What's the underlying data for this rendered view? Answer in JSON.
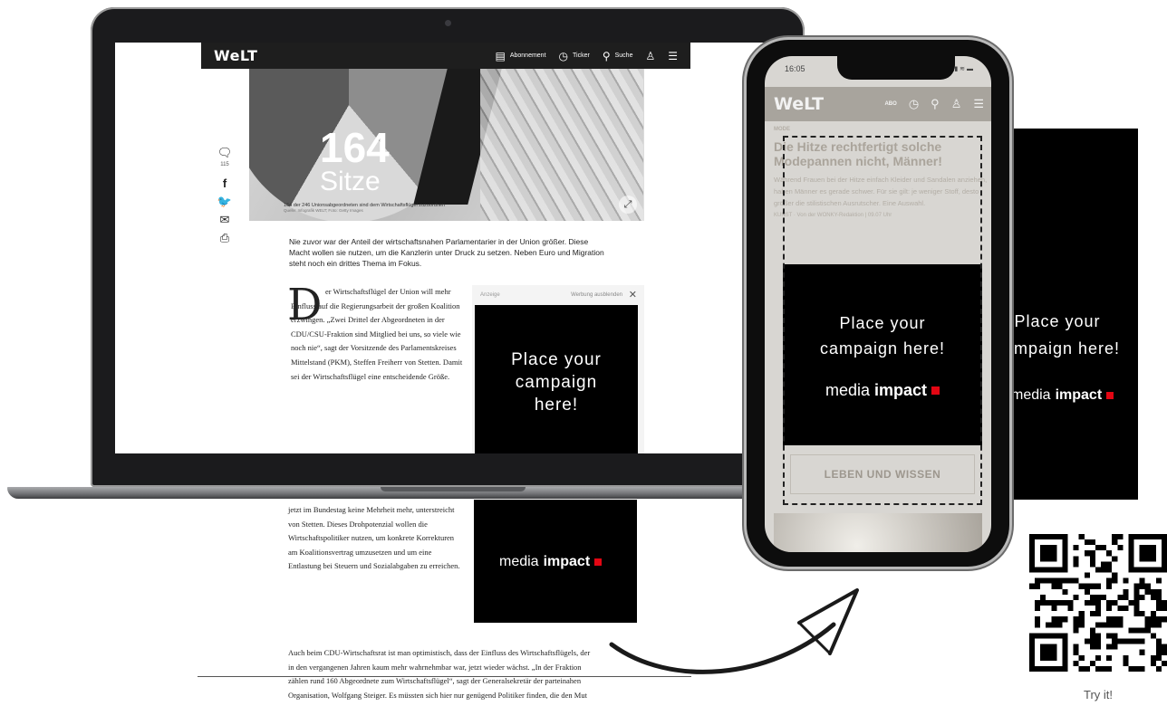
{
  "laptop": {
    "site": {
      "logo": "WeLT",
      "nav": [
        {
          "label": "Abonnement",
          "icon": "newspaper-icon"
        },
        {
          "label": "Ticker",
          "icon": "ticker-icon"
        },
        {
          "label": "Suche",
          "icon": "search-icon"
        }
      ]
    },
    "hero": {
      "number": "164",
      "word": "Sitze",
      "caption": "164 der 246 Unionsabgeordneten sind dem Wirtschaftsflügel zuzuordnen",
      "credit": "Quelle: Infografik WELT; Foto: Getty Images"
    },
    "social": {
      "comment_count": "115"
    },
    "lead": "Nie zuvor war der Anteil der wirtschaftsnahen Parlamentarier in der Union größer. Diese Macht wollen sie nutzen, um die Kanzlerin unter Druck zu setzen. Neben Euro und Migration steht noch ein drittes Thema im Fokus.",
    "dropcap": "D",
    "body": "er Wirtschaftsflügel der Union will mehr Einfluss auf die Regierungsarbeit der großen Koalition erzwingen. „Zwei Drittel der Abgeordneten in der CDU/CSU-Fraktion sind Mitglied bei uns, so viele wie noch nie“, sagt der Vorsitzende des Parlamentskreises Mittelstand (PKM), Steffen Freiherr von Stetten. Damit sei der Wirtschaftsflügel eine entscheidende Größe.",
    "ad": {
      "label": "Anzeige",
      "hide": "Werbung ausblenden",
      "text": "Place your campaign here!"
    }
  },
  "below_page": {
    "text": "jetzt im Bundestag keine Mehrheit mehr, unterstreicht von Stetten. Dieses Drohpotenzial wollen die Wirtschaftspolitiker nutzen, um konkrete Korrekturen am Koalitionsvertrag umzusetzen und um eine Entlastung bei Steuern und Sozialabgaben zu erreichen.",
    "para": "Auch beim CDU-Wirtschaftsrat ist man optimistisch, dass der Einfluss des Wirtschaftsflügels, der in den vergangenen Jahren kaum mehr wahrnehmbar war, jetzt wieder wächst. „In der Fraktion zählen rund 160 Abgeordnete zum Wirtschaftsflügel“, sagt der Generalsekretär der parteinahen Organisation, Wolfgang Steiger. Es müssten sich hier nur genügend Politiker finden, die den Mut hätten, der Regierung auch mal die Stirn zu bieten."
  },
  "brand": {
    "media": "media",
    "impact": "impact",
    "accent": "#e30613"
  },
  "phone": {
    "time": "16:05",
    "logo": "WeLT",
    "abo": "ABO",
    "kicker": "MODE",
    "title": "Die Hitze rechtfertigt solche Modepannen nicht, Männer!",
    "body": "Während Frauen bei der Hitze einfach Kleider und Sandalen anziehen, haben Männer es gerade schwer. Für sie gilt: je weniger Stoff, desto größer die stilistischen Ausrutscher. Eine Auswahl.",
    "meta": "KUNST · Von der WONKY-Redaktion | 09.07 Uhr",
    "ad_text": "Place your campaign here!",
    "section": "LEBEN UND WISSEN"
  },
  "right_panel": {
    "text": "Place your campaign here!"
  },
  "qr": {
    "caption": "Try it!"
  }
}
